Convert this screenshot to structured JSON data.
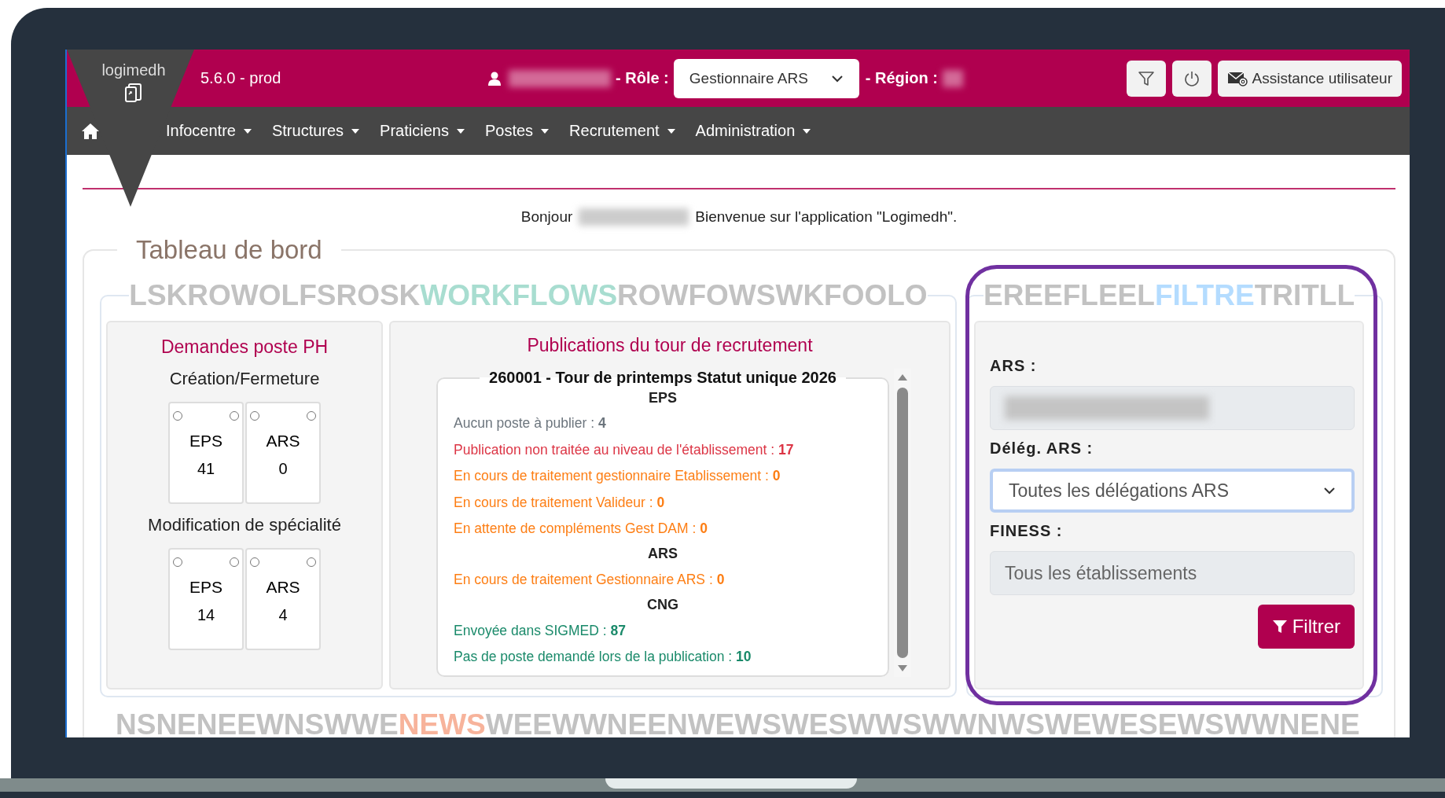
{
  "header": {
    "logo": "logimedh",
    "version": "5.6.0 - prod",
    "role_label": "- Rôle :",
    "role_value": "Gestionnaire ARS",
    "region_label": "- Région :",
    "assistance": "Assistance utilisateur"
  },
  "nav": [
    {
      "label": "Infocentre"
    },
    {
      "label": "Structures"
    },
    {
      "label": "Praticiens"
    },
    {
      "label": "Postes"
    },
    {
      "label": "Recrutement"
    },
    {
      "label": "Administration"
    }
  ],
  "greeting": {
    "before": "Bonjour",
    "after": "Bienvenue sur l'application \"Logimedh\"."
  },
  "dashboard": {
    "title": "Tableau de bord"
  },
  "workflows": {
    "heading": {
      "left": "LSKROWOLFSROSK",
      "main": "WORKFLOWS",
      "right": "ROWFOWSWKFOOLO"
    },
    "demandes": {
      "title": "Demandes poste PH",
      "groups": [
        {
          "title": "Création/Fermeture",
          "tiles": [
            {
              "label": "EPS",
              "count": "41"
            },
            {
              "label": "ARS",
              "count": "0"
            }
          ]
        },
        {
          "title": "Modification de spécialité",
          "tiles": [
            {
              "label": "EPS",
              "count": "14"
            },
            {
              "label": "ARS",
              "count": "4"
            }
          ]
        }
      ]
    },
    "publications": {
      "title": "Publications du tour de recrutement",
      "round": "260001 - Tour de printemps Statut unique 2026",
      "sections": [
        {
          "title": "EPS",
          "lines": [
            {
              "text": "Aucun poste à publier :",
              "value": "4",
              "color": "#6c757d"
            },
            {
              "text": "Publication non traitée au niveau de l'établissement :",
              "value": "17",
              "color": "#dc3545"
            },
            {
              "text": "En cours de traitement gestionnaire Etablissement :",
              "value": "0",
              "color": "#fd7e14"
            },
            {
              "text": "En cours de traitement Valideur :",
              "value": "0",
              "color": "#fd7e14"
            },
            {
              "text": "En attente de compléments Gest DAM :",
              "value": "0",
              "color": "#fd7e14"
            }
          ]
        },
        {
          "title": "ARS",
          "lines": [
            {
              "text": "En cours de traitement Gestionnaire ARS :",
              "value": "0",
              "color": "#fd7e14"
            }
          ]
        },
        {
          "title": "CNG",
          "lines": [
            {
              "text": "Envoyée dans SIGMED :",
              "value": "87",
              "color": "#1a8a6a"
            },
            {
              "text": "Pas de poste demandé lors de la publication :",
              "value": "10",
              "color": "#1a8a6a"
            }
          ]
        }
      ]
    }
  },
  "filter": {
    "heading": {
      "left": "EREEFLEEL",
      "main": "FILTRE",
      "right": "TRITLL"
    },
    "fields": [
      {
        "label": "ARS :",
        "kind": "readonly"
      },
      {
        "label": "Délég. ARS :",
        "kind": "select",
        "value": "Toutes les délégations ARS"
      },
      {
        "label": "FINESS :",
        "kind": "input",
        "placeholder": "Tous les établissements"
      }
    ],
    "button": "Filtrer"
  },
  "news": {
    "heading": {
      "left": "NSNENEEWNSWWE",
      "main": "NEWS",
      "right": "WEEWWNEENWEWSWESWWSWWNWSWEWESEWSWWNENE"
    }
  }
}
